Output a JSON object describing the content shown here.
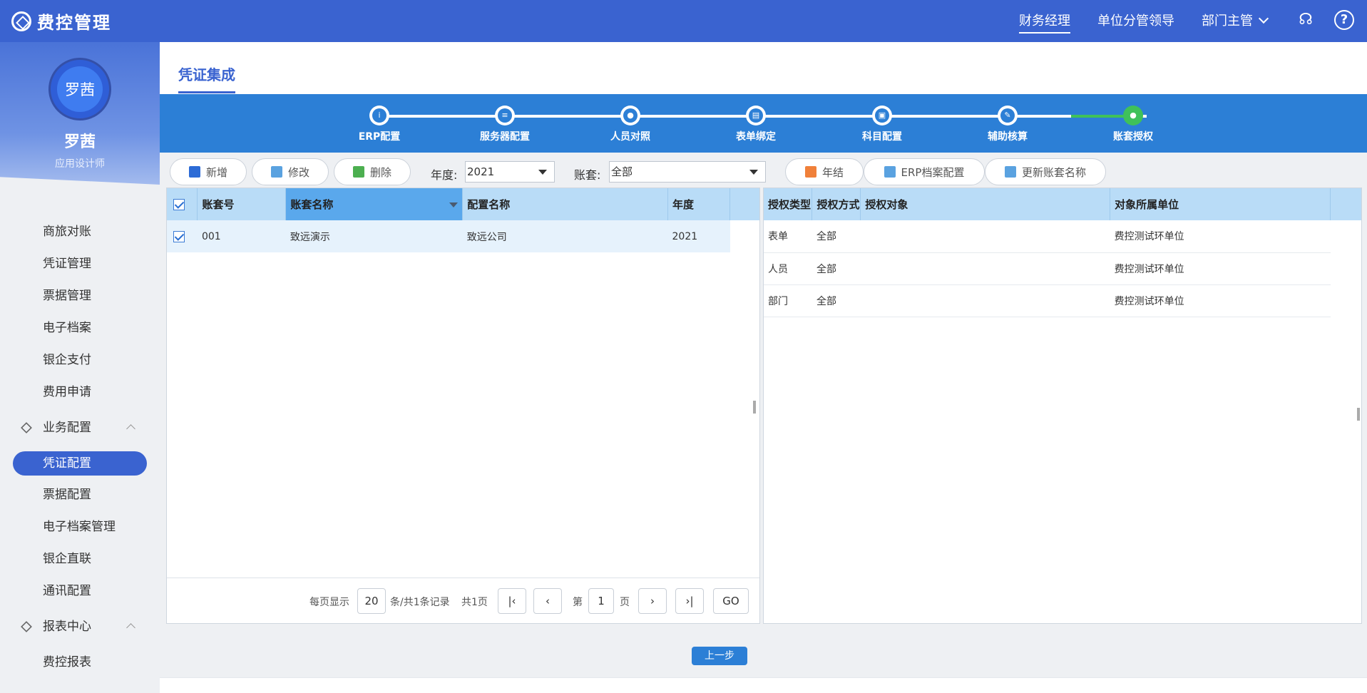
{
  "app": {
    "title": "费控管理"
  },
  "roles": [
    "财务经理",
    "单位分管领导",
    "部门主管"
  ],
  "user": {
    "avatar_text": "罗茜",
    "name": "罗茜",
    "role": "应用设计师"
  },
  "menu": {
    "items_top": [
      "商旅对账",
      "凭证管理",
      "票据管理",
      "电子档案",
      "银企支付",
      "费用申请"
    ],
    "group1": "业务配置",
    "group1_items": [
      "凭证配置",
      "票据配置",
      "电子档案管理",
      "银企直联",
      "通讯配置"
    ],
    "group2": "报表中心",
    "group2_items": [
      "费控报表"
    ]
  },
  "page": {
    "tab": "凭证集成"
  },
  "steps": [
    "ERP配置",
    "服务器配置",
    "人员对照",
    "表单绑定",
    "科目配置",
    "辅助核算",
    "账套授权"
  ],
  "toolbar": {
    "add": "新增",
    "edit": "修改",
    "delete": "删除",
    "year_label": "年度:",
    "year_value": "2021",
    "book_label": "账套:",
    "book_value": "全部",
    "year_close": "年结",
    "erp_config": "ERP档案配置",
    "update_name": "更新账套名称"
  },
  "left_table": {
    "headers": [
      "账套号",
      "账套名称",
      "配置名称",
      "年度"
    ],
    "rows": [
      {
        "code": "001",
        "name": "致远演示",
        "config": "致远公司",
        "year": "2021"
      }
    ]
  },
  "right_table": {
    "headers": [
      "授权类型",
      "授权方式",
      "授权对象",
      "对象所属单位"
    ],
    "rows": [
      {
        "type": "表单",
        "mode": "全部",
        "target": "",
        "unit": "费控测试环单位"
      },
      {
        "type": "人员",
        "mode": "全部",
        "target": "",
        "unit": "费控测试环单位"
      },
      {
        "type": "部门",
        "mode": "全部",
        "target": "",
        "unit": "费控测试环单位"
      }
    ]
  },
  "pager": {
    "per_page_label": "每页显示",
    "per_page": "20",
    "records": "条/共1条记录",
    "total_pages": "共1页",
    "page_prefix": "第",
    "page": "1",
    "page_suffix": "页",
    "go": "GO"
  },
  "footer": {
    "prev": "上一步"
  },
  "colors": {
    "primary": "#3a63d0",
    "stepper": "#2c7fd6",
    "done": "#3fc15a",
    "header_row": "#b9dcf7"
  }
}
